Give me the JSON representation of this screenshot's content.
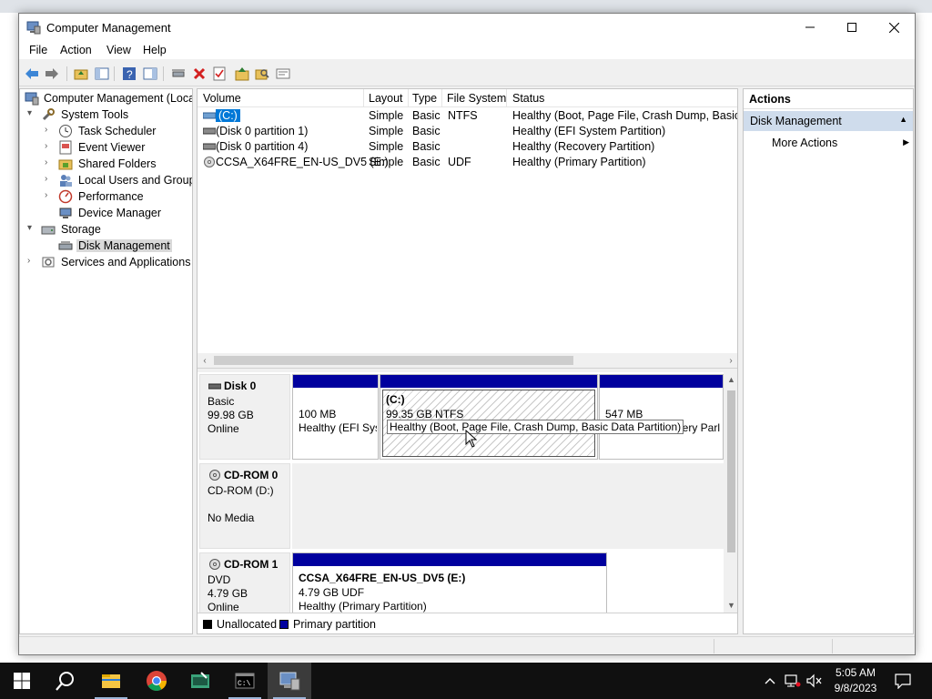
{
  "window": {
    "title": "Computer Management"
  },
  "menu": [
    "File",
    "Action",
    "View",
    "Help"
  ],
  "tree": {
    "root": "Computer Management (Local)",
    "system_tools": "System Tools",
    "task_scheduler": "Task Scheduler",
    "event_viewer": "Event Viewer",
    "shared_folders": "Shared Folders",
    "local_users": "Local Users and Groups",
    "performance": "Performance",
    "device_manager": "Device Manager",
    "storage": "Storage",
    "disk_management": "Disk Management",
    "services": "Services and Applications"
  },
  "volumes": {
    "headers": [
      "Volume",
      "Layout",
      "Type",
      "File System",
      "Status"
    ],
    "rows": [
      {
        "volume": "(C:)",
        "layout": "Simple",
        "type": "Basic",
        "fs": "NTFS",
        "status": "Healthy (Boot, Page File, Crash Dump, Basic Da"
      },
      {
        "volume": "(Disk 0 partition 1)",
        "layout": "Simple",
        "type": "Basic",
        "fs": "",
        "status": "Healthy (EFI System Partition)"
      },
      {
        "volume": "(Disk 0 partition 4)",
        "layout": "Simple",
        "type": "Basic",
        "fs": "",
        "status": "Healthy (Recovery Partition)"
      },
      {
        "volume": "CCSA_X64FRE_EN-US_DV5 (E:)",
        "layout": "Simple",
        "type": "Basic",
        "fs": "UDF",
        "status": "Healthy (Primary Partition)"
      }
    ]
  },
  "disks": {
    "disk0": {
      "name": "Disk 0",
      "type": "Basic",
      "size": "99.98 GB",
      "state": "Online",
      "p1": {
        "size": "100 MB",
        "status": "Healthy (EFI Sys"
      },
      "p2": {
        "name": "(C:)",
        "size": "99.35 GB NTFS"
      },
      "p3": {
        "size": "547 MB",
        "status": "overy Parl"
      },
      "tooltip": "Healthy (Boot, Page File, Crash Dump, Basic Data Partition)"
    },
    "cdrom0": {
      "name": "CD-ROM 0",
      "drive": "CD-ROM (D:)",
      "media": "No Media"
    },
    "cdrom1": {
      "name": "CD-ROM 1",
      "type": "DVD",
      "size": "4.79 GB",
      "state": "Online",
      "p1": {
        "name": "CCSA_X64FRE_EN-US_DV5  (E:)",
        "size": "4.79 GB UDF",
        "status": "Healthy (Primary Partition)"
      }
    }
  },
  "legend": {
    "unallocated": "Unallocated",
    "primary": "Primary partition"
  },
  "actions": {
    "title": "Actions",
    "section": "Disk Management",
    "more": "More Actions"
  },
  "clock": {
    "time": "5:05 AM",
    "date": "9/8/2023"
  },
  "colors": {
    "primary_partition": "#00009e",
    "selection": "#0078d7",
    "actions_header": "#cfdcec",
    "taskbar": "#101010"
  }
}
